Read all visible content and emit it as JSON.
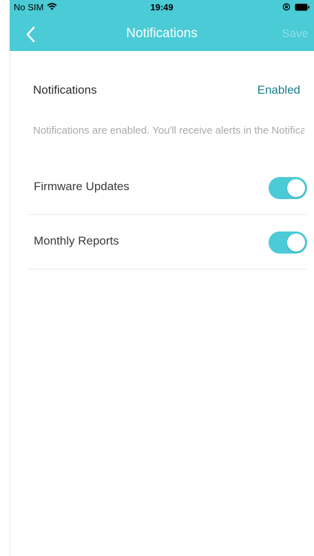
{
  "status_bar": {
    "carrier": "No SIM",
    "time": "19:49",
    "wifi_icon": "wifi-icon",
    "lock_icon": "orientation-lock-icon",
    "battery_icon": "battery-icon"
  },
  "nav": {
    "title": "Notifications",
    "save_label": "Save",
    "back_icon": "chevron-left-icon"
  },
  "notifications": {
    "label": "Notifications",
    "status": "Enabled",
    "description": "Notifications are enabled. You'll receive alerts in the Notifications bar. Disable it on your device's"
  },
  "settings": [
    {
      "label": "Firmware Updates",
      "enabled": true
    },
    {
      "label": "Monthly Reports",
      "enabled": true
    }
  ],
  "colors": {
    "accent": "#4acbd6",
    "link": "#177d8e",
    "save_disabled": "#8fe1e8"
  }
}
